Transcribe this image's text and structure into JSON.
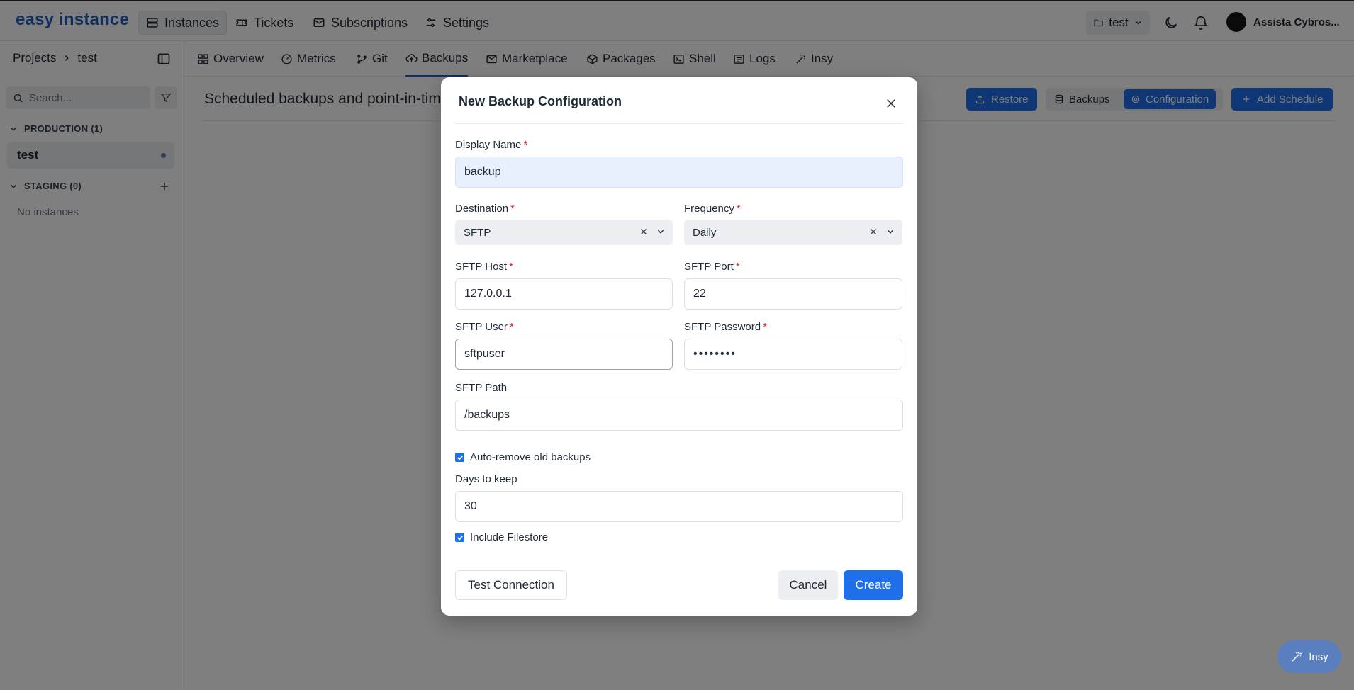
{
  "app": {
    "logo": "easy instance",
    "nav": [
      {
        "label": "Instances",
        "icon": "server-icon",
        "active": true
      },
      {
        "label": "Tickets",
        "icon": "ticket-icon",
        "active": false
      },
      {
        "label": "Subscriptions",
        "icon": "mail-icon",
        "active": false
      },
      {
        "label": "Settings",
        "icon": "sliders-icon",
        "active": false
      }
    ],
    "project_switch": "test",
    "user_name": "Assista Cybros..."
  },
  "sidebar": {
    "breadcrumb_root": "Projects",
    "breadcrumb_current": "test",
    "search_placeholder": "Search...",
    "groups": [
      {
        "label": "PRODUCTION (1)",
        "items": [
          "test"
        ]
      },
      {
        "label": "STAGING (0)",
        "empty_text": "No instances"
      }
    ]
  },
  "subnav": [
    {
      "label": "Overview",
      "icon": "grid-icon",
      "active": false
    },
    {
      "label": "Metrics",
      "icon": "gauge-icon",
      "active": false
    },
    {
      "label": "Git",
      "icon": "git-icon",
      "active": false
    },
    {
      "label": "Backups",
      "icon": "cloud-upload-icon",
      "active": true
    },
    {
      "label": "Marketplace",
      "icon": "store-icon",
      "active": false
    },
    {
      "label": "Packages",
      "icon": "package-icon",
      "active": false
    },
    {
      "label": "Shell",
      "icon": "terminal-icon",
      "active": false
    },
    {
      "label": "Logs",
      "icon": "list-icon",
      "active": false
    },
    {
      "label": "Insy",
      "icon": "wand-icon",
      "active": false
    }
  ],
  "page": {
    "title": "Scheduled backups and point-in-tim",
    "restore_label": "Restore",
    "seg_backups_label": "Backups",
    "seg_config_label": "Configuration",
    "add_schedule_label": "Add Schedule"
  },
  "fab_label": "Insy",
  "modal": {
    "title": "New Backup Configuration",
    "display_name": {
      "label": "Display Name",
      "value": "backup"
    },
    "destination": {
      "label": "Destination",
      "value": "SFTP"
    },
    "frequency": {
      "label": "Frequency",
      "value": "Daily"
    },
    "sftp_host": {
      "label": "SFTP Host",
      "value": "127.0.0.1"
    },
    "sftp_port": {
      "label": "SFTP Port",
      "value": "22"
    },
    "sftp_user": {
      "label": "SFTP User",
      "value": "sftpuser"
    },
    "sftp_password": {
      "label": "SFTP Password",
      "value": "••••••••"
    },
    "sftp_path": {
      "label": "SFTP Path",
      "value": "/backups"
    },
    "auto_remove": {
      "label": "Auto-remove old backups",
      "checked": true
    },
    "days_to_keep": {
      "label": "Days to keep",
      "value": "30"
    },
    "include_filestore": {
      "label": "Include Filestore",
      "checked": true
    },
    "test_connection_label": "Test Connection",
    "cancel_label": "Cancel",
    "create_label": "Create"
  },
  "colors": {
    "accent": "#1f6feb",
    "brand": "#1f5fbf",
    "required": "#dc2626"
  }
}
